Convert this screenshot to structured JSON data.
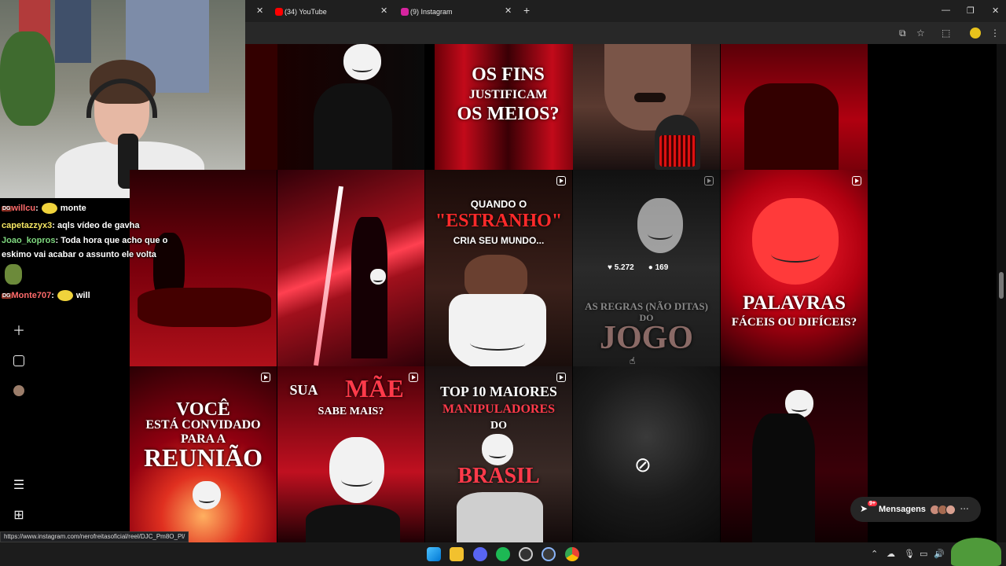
{
  "browser": {
    "tabs": [
      {
        "label": "(34) YouTube",
        "favicon": "youtube-icon",
        "color": "#ff0000"
      },
      {
        "label": "(9) Instagram",
        "favicon": "instagram-icon",
        "color": "#d6249f"
      }
    ],
    "new_tab": "+",
    "window_controls": {
      "minimize": "—",
      "restore": "❐",
      "close": "✕"
    },
    "tab_close": "✕"
  },
  "nav_icons": [
    "create-icon",
    "dashboard-icon",
    "profile-avatar",
    "menu-icon",
    "more-icon"
  ],
  "grid": [
    {
      "text1": "",
      "text2": "",
      "text3": ""
    },
    {
      "text1": "OS FINS",
      "text2": "JUSTIFICAM",
      "text3": "OS MEIOS?"
    },
    {
      "text1": "",
      "text2": "",
      "text3": ""
    },
    {
      "text1": "",
      "text2": "",
      "text3": ""
    },
    {
      "text1": "",
      "text2": "",
      "text3": ""
    },
    {
      "text1": "",
      "text2": "",
      "text3": ""
    },
    {
      "text1": "QUANDO O",
      "text2": "\"ESTRANHO\"",
      "text3": "CRIA SEU MUNDO..."
    },
    {
      "text1": "AS REGRAS (NÃO DITAS)",
      "text2": "DO",
      "text3": "JOGO",
      "likes": "5.272",
      "comments": "169"
    },
    {
      "text1": "PALAVRAS",
      "text2": "FÁCEIS OU DIFÍCEIS?",
      "text3": ""
    },
    {
      "text1": "VOCÊ",
      "text2": "ESTÁ CONVIDADO",
      "text3": "PARA A",
      "text4": "REUNIÃO"
    },
    {
      "text1": "SUA",
      "text2": "MÃE",
      "text3": "SABE MAIS?"
    },
    {
      "text1": "TOP 10 MAIORES",
      "text2": "MANIPULADORES",
      "text3": "DO",
      "text4": "BRASIL"
    },
    {
      "text1": "",
      "text2": "",
      "text3": ""
    },
    {
      "text1": "",
      "text2": "",
      "text3": ""
    }
  ],
  "chat": [
    {
      "user": "willcu",
      "user_color": "#ff6b6b",
      "sep": ":",
      "msg": "monte",
      "badge": "DG"
    },
    {
      "user": "capetazzyx3",
      "user_color": "#f5e663",
      "sep": ":",
      "msg": "aqls vídeo de gavha"
    },
    {
      "user": "Joao_kopros",
      "user_color": "#7fd97f",
      "sep": ":",
      "msg": "Toda hora que acho que o"
    },
    {
      "msg": "eskimo vai acabar o assunto ele volta"
    },
    {
      "user": "Monte707",
      "user_color": "#ff6b6b",
      "sep": ":",
      "msg": "will",
      "badge": "DG"
    }
  ],
  "messages": {
    "label": "Mensagens",
    "badge": "9+"
  },
  "status_url": "https://www.instagram.com/nerofreitasoficial/reel/DJC_Pm8O_Pl/",
  "colors": {
    "accent_red": "#d41b2c",
    "instagram_bg": "#000000"
  }
}
